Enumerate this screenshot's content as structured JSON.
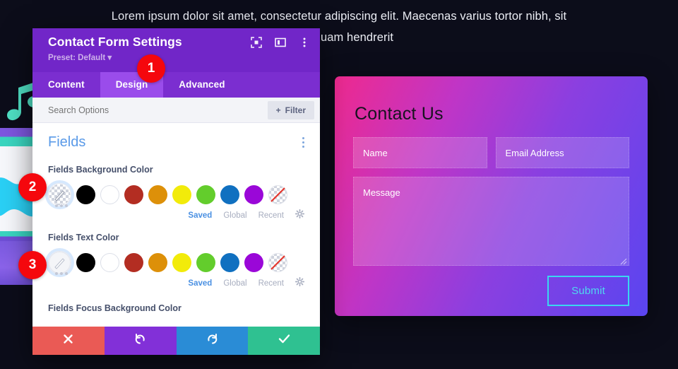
{
  "background": {
    "page_text": "Lorem ipsum dolor sit amet, consectetur adipiscing elit. Maecenas varius tortor nibh, sit\namet                                                                                    quam hendrerit",
    "canvas_color": "#0c0d1a"
  },
  "contact_form": {
    "title": "Contact Us",
    "fields": [
      {
        "placeholder": "Name"
      },
      {
        "placeholder": "Email Address"
      },
      {
        "placeholder": "Message"
      }
    ],
    "submit_label": "Submit",
    "accent_color": "#3ad7f0",
    "gradient_from": "#ef2a8f",
    "gradient_to": "#5a45f0"
  },
  "modal": {
    "title": "Contact Form Settings",
    "preset": "Preset: Default",
    "header_icons": [
      "focus-icon",
      "layout-icon",
      "kebab-menu-icon"
    ],
    "tabs": [
      {
        "label": "Content",
        "active": false
      },
      {
        "label": "Design",
        "active": true
      },
      {
        "label": "Advanced",
        "active": false
      }
    ],
    "search": {
      "placeholder": "Search Options"
    },
    "filter_label": "Filter",
    "section": {
      "title": "Fields"
    },
    "options": [
      {
        "label": "Fields Background Color",
        "selected_swatch": "transparent-checkerboard",
        "swatches": [
          "#000000",
          "#ffffff",
          "#b32d22",
          "#dd9009",
          "#f2eb0a",
          "#63cd2c",
          "#1070c0",
          "#9a07d8",
          "none"
        ],
        "tabs": [
          {
            "label": "Saved",
            "active": true
          },
          {
            "label": "Global",
            "active": false
          },
          {
            "label": "Recent",
            "active": false
          }
        ],
        "settings_icon": "gear-icon"
      },
      {
        "label": "Fields Text Color",
        "selected_swatch": "white-eyedropper",
        "swatches": [
          "#000000",
          "#ffffff",
          "#b32d22",
          "#dd9009",
          "#f2eb0a",
          "#63cd2c",
          "#1070c0",
          "#9a07d8",
          "none"
        ],
        "tabs": [
          {
            "label": "Saved",
            "active": true
          },
          {
            "label": "Global",
            "active": false
          },
          {
            "label": "Recent",
            "active": false
          }
        ],
        "settings_icon": "gear-icon"
      },
      {
        "label": "Fields Focus Background Color"
      }
    ],
    "footer": [
      {
        "name": "cancel",
        "icon": "close-icon",
        "color": "#ea5a55"
      },
      {
        "name": "undo",
        "icon": "undo-icon",
        "color": "#8230d8"
      },
      {
        "name": "redo",
        "icon": "redo-icon",
        "color": "#2a8cd6"
      },
      {
        "name": "save",
        "icon": "check-icon",
        "color": "#2fc191"
      }
    ]
  },
  "badges": [
    {
      "number": "1"
    },
    {
      "number": "2"
    },
    {
      "number": "3"
    }
  ]
}
